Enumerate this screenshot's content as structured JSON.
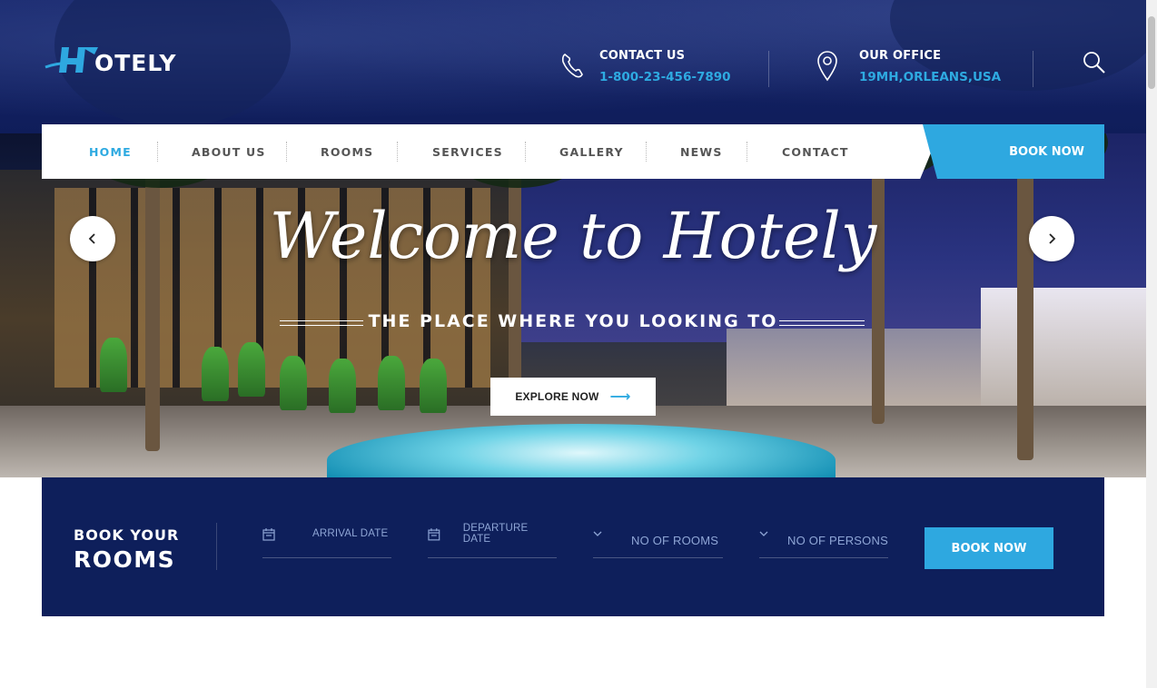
{
  "brand": {
    "logo_text": "OTELY"
  },
  "header": {
    "contact": {
      "label": "CONTACT US",
      "value": "1-800-23-456-7890"
    },
    "office": {
      "label": "OUR OFFICE",
      "value": "19MH,ORLEANS,USA"
    }
  },
  "nav": {
    "items": [
      "HOME",
      "ABOUT US",
      "ROOMS",
      "SERVICES",
      "GALLERY",
      "NEWS",
      "CONTACT"
    ],
    "active": "HOME",
    "book_label": "BOOK NOW"
  },
  "hero": {
    "title": "Welcome to Hotely",
    "subtitle": "THE PLACE WHERE YOU LOOKING TO",
    "cta_label": "EXPLORE NOW",
    "cta_arrow": "⟶"
  },
  "booking": {
    "title_line1": "BOOK YOUR",
    "title_line2": "ROOMS",
    "arrival_placeholder": "ARRIVAL DATE",
    "departure_placeholder": "DEPARTURE DATE",
    "rooms_placeholder": "NO OF ROOMS",
    "persons_placeholder": "NO OF PERSONS",
    "button_label": "BOOK NOW"
  },
  "colors": {
    "accent": "#2ea8e0",
    "navy": "#0e1f5b",
    "header_bg": "#16256a"
  },
  "icons": {
    "phone": "phone-icon",
    "location": "location-pin-icon",
    "search": "search-icon",
    "calendar": "calendar-icon",
    "chevron": "chevron-down-icon",
    "prev": "chevron-left-icon",
    "next": "chevron-right-icon"
  }
}
